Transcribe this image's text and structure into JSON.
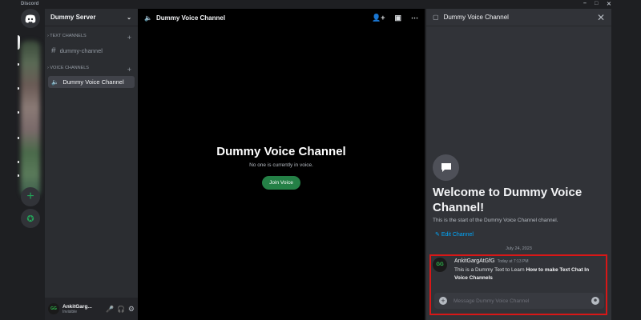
{
  "app": {
    "title": "Discord"
  },
  "server": {
    "name": "Dummy Server"
  },
  "categories": [
    {
      "label": "TEXT CHANNELS",
      "channels": [
        {
          "name": "dummy-channel",
          "type": "text"
        }
      ]
    },
    {
      "label": "VOICE CHANNELS",
      "channels": [
        {
          "name": "Dummy Voice Channel",
          "type": "voice",
          "active": true
        }
      ]
    }
  ],
  "user": {
    "name": "AnkitGarg...",
    "status": "Invisible",
    "avatar": "GG"
  },
  "voice": {
    "header": "Dummy Voice Channel",
    "title": "Dummy Voice Channel",
    "subtitle": "No one is currently in voice.",
    "join_label": "Join Voice"
  },
  "chat": {
    "header": "Dummy Voice Channel",
    "welcome": "Welcome to Dummy Voice Channel!",
    "start_text": "This is the start of the Dummy Voice Channel channel.",
    "edit_label": "Edit Channel",
    "date": "July 24, 2023",
    "message": {
      "author": "AnkitGargAtGfG",
      "time": "Today at 7:13 PM",
      "text": "This is a Dummy Text to Learn ",
      "bold": "How to make Text Chat In Voice Channels",
      "avatar": "GG"
    },
    "input_placeholder": "Message Dummy Voice Channel"
  },
  "colors": {
    "accent": "#248046",
    "highlight": "#d81717",
    "link": "#00a8fc"
  }
}
